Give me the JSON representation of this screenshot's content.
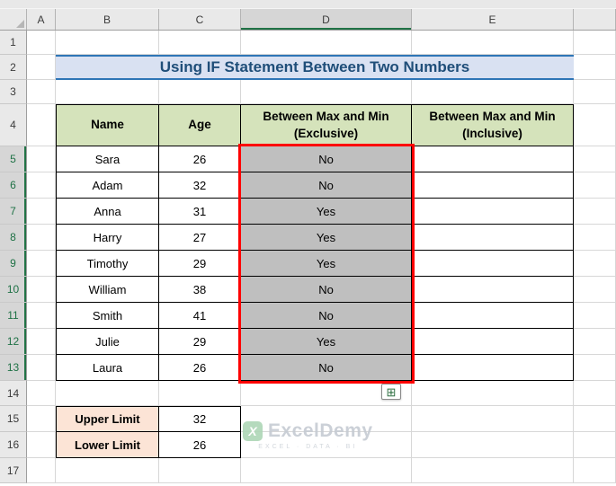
{
  "spreadsheet": {
    "columns": [
      "A",
      "B",
      "C",
      "D",
      "E"
    ],
    "rows": [
      "1",
      "2",
      "3",
      "4",
      "5",
      "6",
      "7",
      "8",
      "9",
      "10",
      "11",
      "12",
      "13",
      "14",
      "15",
      "16",
      "17"
    ],
    "selected_column": "D",
    "selected_range": "D5:D13"
  },
  "title": {
    "text": "Using IF Statement Between Two Numbers"
  },
  "table": {
    "headers": {
      "name": "Name",
      "age": "Age",
      "exclusive": "Between Max and Min (Exclusive)",
      "inclusive": "Between Max and Min (Inclusive)"
    },
    "rows": [
      {
        "name": "Sara",
        "age": "26",
        "exclusive": "No",
        "inclusive": ""
      },
      {
        "name": "Adam",
        "age": "32",
        "exclusive": "No",
        "inclusive": ""
      },
      {
        "name": "Anna",
        "age": "31",
        "exclusive": "Yes",
        "inclusive": ""
      },
      {
        "name": "Harry",
        "age": "27",
        "exclusive": "Yes",
        "inclusive": ""
      },
      {
        "name": "Timothy",
        "age": "29",
        "exclusive": "Yes",
        "inclusive": ""
      },
      {
        "name": "William",
        "age": "38",
        "exclusive": "No",
        "inclusive": ""
      },
      {
        "name": "Smith",
        "age": "41",
        "exclusive": "No",
        "inclusive": ""
      },
      {
        "name": "Julie",
        "age": "29",
        "exclusive": "Yes",
        "inclusive": ""
      },
      {
        "name": "Laura",
        "age": "26",
        "exclusive": "No",
        "inclusive": ""
      }
    ]
  },
  "limits": {
    "upper_label": "Upper Limit",
    "upper_value": "32",
    "lower_label": "Lower Limit",
    "lower_value": "26"
  },
  "watermark": {
    "brand": "ExcelDemy",
    "tagline": "EXCEL · DATA · BI",
    "logo_letter": "X"
  },
  "icons": {
    "autofill_grid": "⊞"
  },
  "colors": {
    "table_header_green": "#D5E3BB",
    "selection_fill_gray": "#BFBFBF",
    "selection_border_red": "#FE0000",
    "title_text_blue": "#1F4E79",
    "title_fill": "#D9E1F2",
    "title_border_blue": "#2E75B6",
    "limit_label_peach": "#FCE4D6",
    "excel_accent_green": "#217346"
  }
}
